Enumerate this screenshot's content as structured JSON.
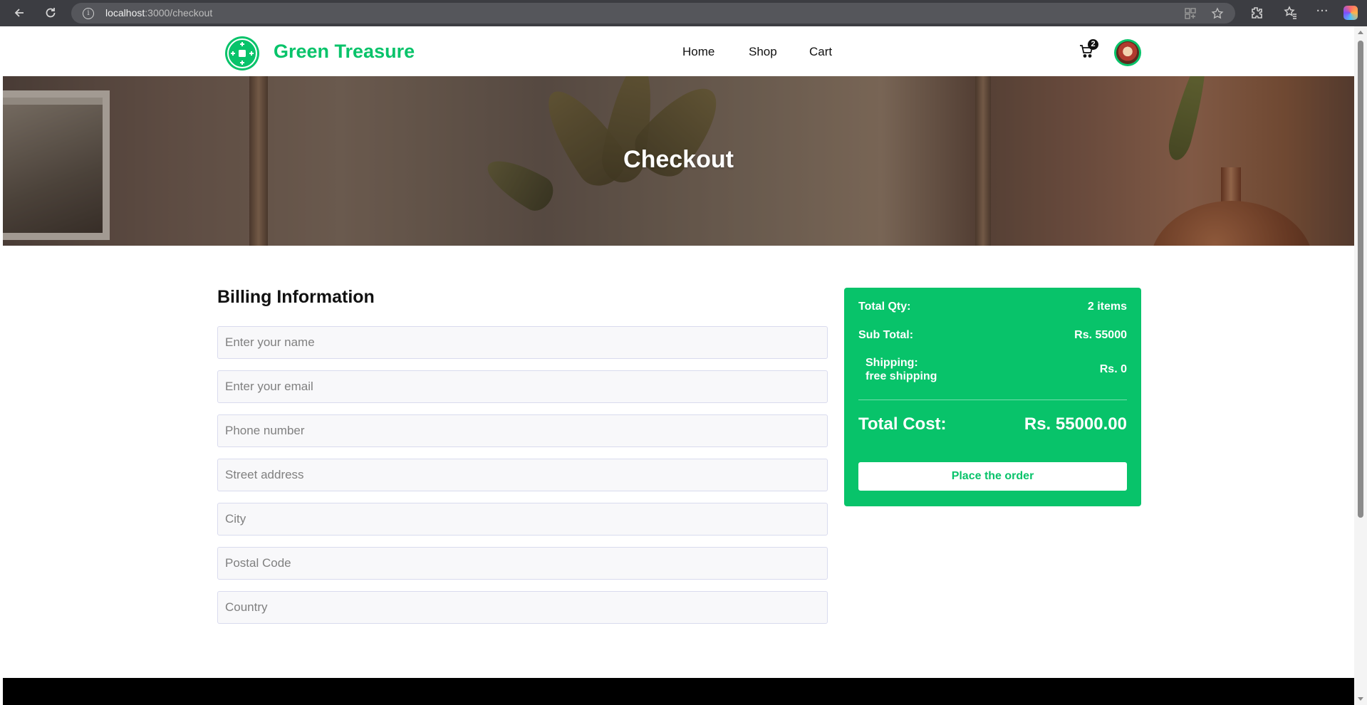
{
  "browser": {
    "url_host": "localhost",
    "url_rest": ":3000/checkout",
    "icons": [
      "back-icon",
      "reload-icon",
      "info-icon",
      "apps-icon",
      "favorite-icon",
      "extensions-icon",
      "favorites-bar-icon",
      "more-icon",
      "copilot-icon"
    ]
  },
  "header": {
    "brand": "Green Treasure",
    "nav": [
      "Home",
      "Shop",
      "Cart"
    ],
    "cart_count": "2"
  },
  "hero": {
    "title": "Checkout"
  },
  "billing": {
    "title": "Billing Information",
    "fields": {
      "name": "Enter your name",
      "email": "Enter your email",
      "phone": "Phone number",
      "street": "Street address",
      "city": "City",
      "postal": "Postal Code",
      "country": "Country"
    }
  },
  "summary": {
    "qty_label": "Total Qty:",
    "qty_value": "2 items",
    "subtotal_label": "Sub Total:",
    "subtotal_value": "Rs. 55000",
    "shipping_label": "Shipping:",
    "shipping_note": "free shipping",
    "shipping_value": "Rs. 0",
    "total_label": "Total Cost:",
    "total_value": "Rs. 55000.00",
    "button": "Place the order"
  },
  "colors": {
    "accent": "#08c36a",
    "footer": "#000000"
  }
}
